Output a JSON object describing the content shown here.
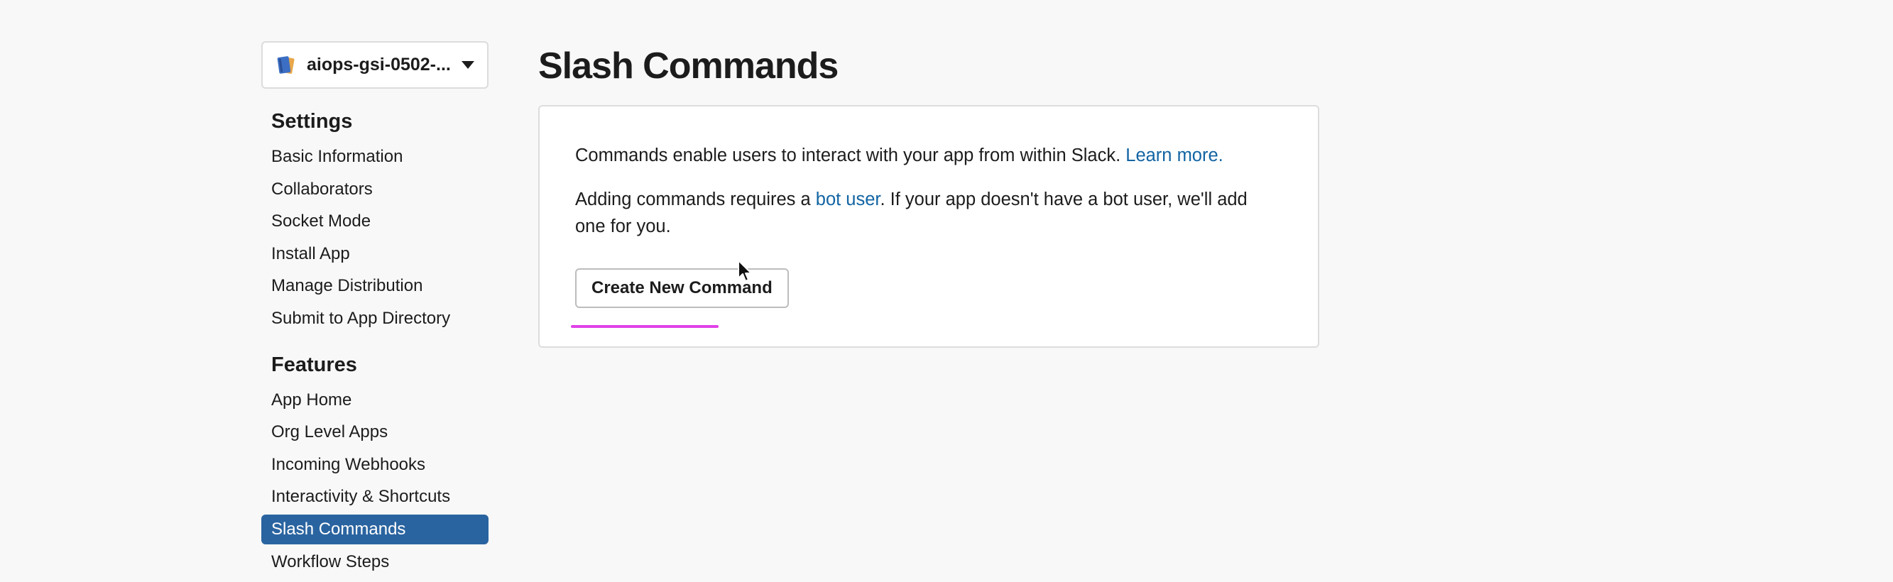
{
  "sidebar": {
    "app_switcher": {
      "name": "aiops-gsi-0502-..."
    },
    "settings": {
      "title": "Settings",
      "items": [
        {
          "label": "Basic Information"
        },
        {
          "label": "Collaborators"
        },
        {
          "label": "Socket Mode"
        },
        {
          "label": "Install App"
        },
        {
          "label": "Manage Distribution"
        },
        {
          "label": "Submit to App Directory"
        }
      ]
    },
    "features": {
      "title": "Features",
      "items": [
        {
          "label": "App Home"
        },
        {
          "label": "Org Level Apps"
        },
        {
          "label": "Incoming Webhooks"
        },
        {
          "label": "Interactivity & Shortcuts"
        },
        {
          "label": "Slash Commands",
          "active": true
        },
        {
          "label": "Workflow Steps"
        }
      ]
    }
  },
  "main": {
    "title": "Slash Commands",
    "card": {
      "para1_text": "Commands enable users to interact with your app from within Slack. ",
      "para1_link": "Learn more.",
      "para2_before": "Adding commands requires a ",
      "para2_link": "bot user",
      "para2_after": ". If your app doesn't have a bot user, we'll add one for you.",
      "button_label": "Create New Command"
    }
  },
  "colors": {
    "accent": "#2a64a0",
    "link": "#1264a3",
    "highlight": "#e040e8",
    "background": "#f8f8f8"
  },
  "icons": {
    "app_icon": "app-book-icon",
    "dropdown": "chevron-down-icon",
    "pointer": "mouse-cursor-icon"
  }
}
